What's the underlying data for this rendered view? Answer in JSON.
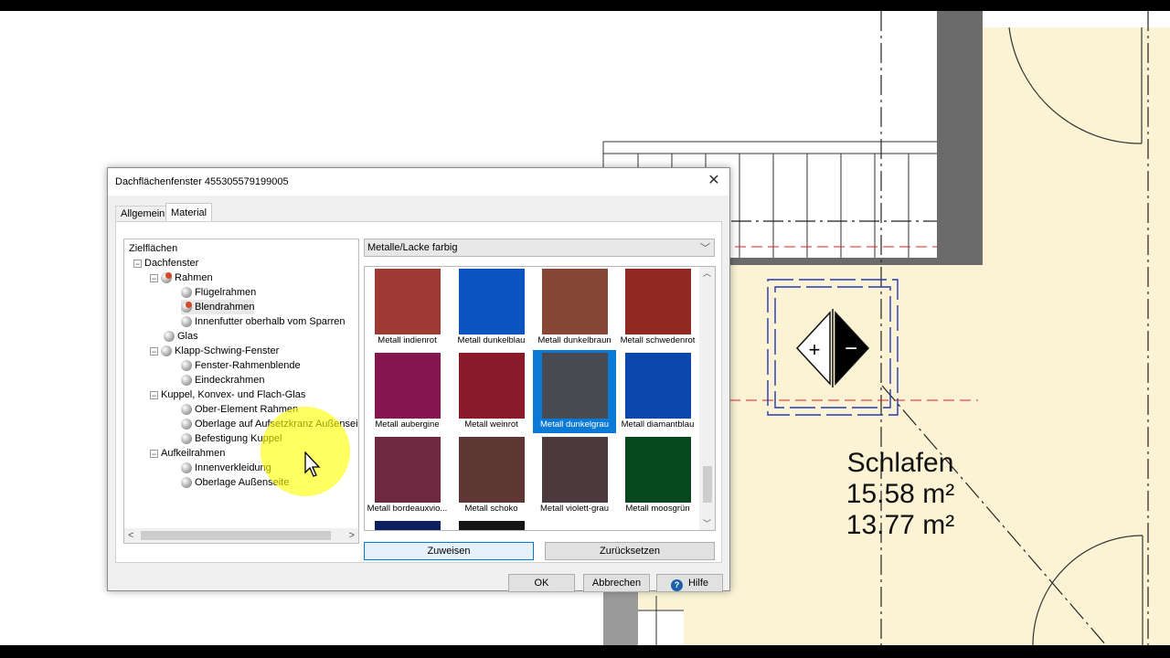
{
  "plan": {
    "room_name": "Schlafen",
    "area_1": "15.58 m²",
    "area_2": "13.77 m²",
    "symbol_plus": "+",
    "symbol_minus": "−"
  },
  "dialog": {
    "title": "Dachflächenfenster 455305579199005",
    "close_icon": "close-icon",
    "tabs": [
      {
        "label": "Allgemein",
        "active": false
      },
      {
        "label": "Material",
        "active": true
      }
    ],
    "tree": {
      "root": "Zielflächen",
      "items": [
        {
          "label": "Dachfenster"
        },
        {
          "label": "Rahmen"
        },
        {
          "label": "Flügelrahmen"
        },
        {
          "label": "Blendrahmen"
        },
        {
          "label": "Innenfutter oberhalb vom Sparren"
        },
        {
          "label": "Glas"
        },
        {
          "label": "Klapp-Schwing-Fenster"
        },
        {
          "label": "Fenster-Rahmenblende"
        },
        {
          "label": "Eindeckrahmen"
        },
        {
          "label": "Kuppel, Konvex- und Flach-Glas"
        },
        {
          "label": "Ober-Element Rahmen"
        },
        {
          "label": "Oberlage auf Aufsetzkranz Außensei"
        },
        {
          "label": "Befestigung Kuppel"
        },
        {
          "label": "Aufkeilrahmen"
        },
        {
          "label": "Innenverkleidung"
        },
        {
          "label": "Oberlage Außenseite"
        }
      ]
    },
    "category": "Metalle/Lacke farbig",
    "swatches": [
      {
        "label": "Metall indienrot",
        "color": "#a03a34"
      },
      {
        "label": "Metall dunkelblau",
        "color": "#0a55bf"
      },
      {
        "label": "Metall dunkelbraun",
        "color": "#884636"
      },
      {
        "label": "Metall schwedenrot",
        "color": "#8f2921"
      },
      {
        "label": "Metall aubergine",
        "color": "#861650"
      },
      {
        "label": "Metall weinrot",
        "color": "#8a1a2a"
      },
      {
        "label": "Metall dunkelgrau",
        "color": "#4a4b52",
        "selected": true
      },
      {
        "label": "Metall diamantblau",
        "color": "#0b48ad"
      },
      {
        "label": "Metall bordeauxvio...",
        "color": "#6e2941"
      },
      {
        "label": "Metall schoko",
        "color": "#5e3735"
      },
      {
        "label": "Metall violett-grau",
        "color": "#4b393d"
      },
      {
        "label": "Metall moosgrün",
        "color": "#07481f"
      },
      {
        "label": "",
        "color": "#0d1f5e"
      },
      {
        "label": "",
        "color": "#151515"
      }
    ],
    "buttons": {
      "assign": "Zuweisen",
      "reset": "Zurücksetzen",
      "ok": "OK",
      "cancel": "Abbrechen",
      "help": "Hilfe"
    },
    "help_icon_glyph": "?"
  }
}
